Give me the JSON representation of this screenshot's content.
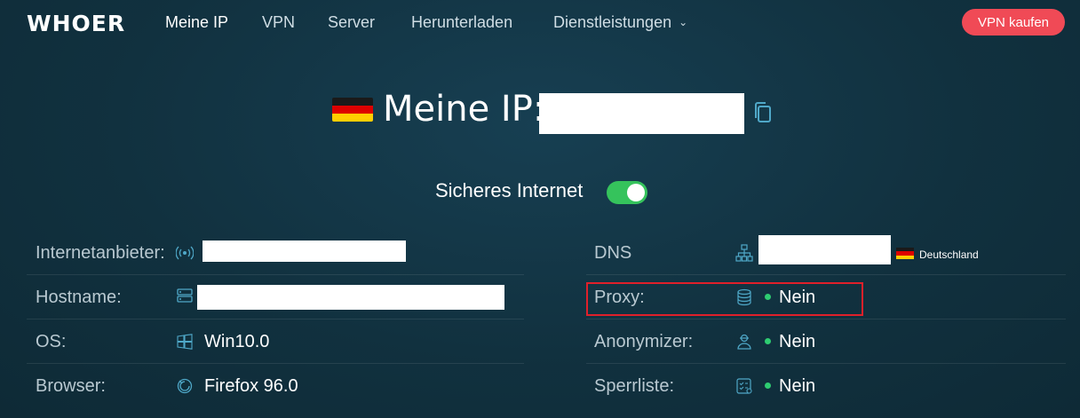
{
  "brand": {
    "logo": "WHOER"
  },
  "nav": {
    "items": [
      {
        "label": "Meine IP",
        "active": true
      },
      {
        "label": "VPN"
      },
      {
        "label": "Server"
      },
      {
        "label": "Herunterladen"
      },
      {
        "label": "Dienstleistungen",
        "has_dropdown": true
      }
    ],
    "buy_button": "VPN kaufen"
  },
  "hero": {
    "title": "Meine IP:",
    "flag": "germany",
    "copy_icon": "copy-icon"
  },
  "secure": {
    "label": "Sicheres Internet",
    "enabled": true,
    "color": "#35c35c"
  },
  "info_left": [
    {
      "label": "Internetanbieter:",
      "icon": "antenna-icon"
    },
    {
      "label": "Hostname:",
      "icon": "server-icon"
    },
    {
      "label": "OS:",
      "icon": "windows-icon",
      "value": "Win10.0"
    },
    {
      "label": "Browser:",
      "icon": "browser-icon",
      "value": "Firefox 96.0"
    }
  ],
  "info_right": [
    {
      "label": "DNS",
      "icon": "network-icon",
      "country": "Deutschland"
    },
    {
      "label": "Proxy:",
      "icon": "database-icon",
      "value": "Nein",
      "status_color": "#2ecc71"
    },
    {
      "label": "Anonymizer:",
      "icon": "user-icon",
      "value": "Nein",
      "status_color": "#2ecc71"
    },
    {
      "label": "Sperrliste:",
      "icon": "checklist-icon",
      "value": "Nein",
      "status_color": "#2ecc71"
    }
  ],
  "colors": {
    "accent": "#f04a56",
    "highlight": "#e0202a"
  }
}
